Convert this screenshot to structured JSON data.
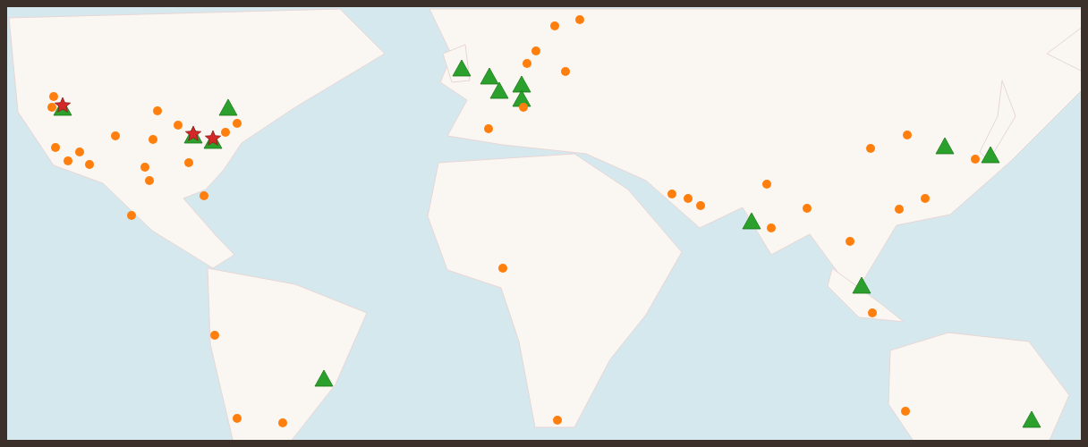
{
  "markers": [
    {
      "kind": "triangle",
      "color": "#2ca02c"
    },
    {
      "kind": "triangle",
      "color": "#2ca02c"
    },
    {
      "kind": "triangle",
      "color": "#2ca02c"
    },
    {
      "kind": "triangle",
      "color": "#2ca02c"
    },
    {
      "kind": "triangle",
      "color": "#2ca02c"
    },
    {
      "kind": "triangle",
      "color": "#2ca02c"
    },
    {
      "kind": "triangle",
      "color": "#2ca02c"
    },
    {
      "kind": "triangle",
      "color": "#2ca02c"
    },
    {
      "kind": "triangle",
      "color": "#2ca02c"
    },
    {
      "kind": "triangle",
      "color": "#2ca02c"
    },
    {
      "kind": "triangle",
      "color": "#2ca02c"
    },
    {
      "kind": "triangle",
      "color": "#2ca02c"
    },
    {
      "kind": "triangle",
      "color": "#2ca02c"
    },
    {
      "kind": "triangle",
      "color": "#2ca02c"
    },
    {
      "kind": "triangle",
      "color": "#2ca02c"
    },
    {
      "kind": "circle",
      "color": "#ff7f0e"
    },
    {
      "kind": "circle",
      "color": "#ff7f0e"
    },
    {
      "kind": "circle",
      "color": "#ff7f0e"
    },
    {
      "kind": "circle",
      "color": "#ff7f0e"
    },
    {
      "kind": "circle",
      "color": "#ff7f0e"
    },
    {
      "kind": "circle",
      "color": "#ff7f0e"
    },
    {
      "kind": "circle",
      "color": "#ff7f0e"
    },
    {
      "kind": "circle",
      "color": "#ff7f0e"
    },
    {
      "kind": "circle",
      "color": "#ff7f0e"
    },
    {
      "kind": "circle",
      "color": "#ff7f0e"
    },
    {
      "kind": "circle",
      "color": "#ff7f0e"
    },
    {
      "kind": "circle",
      "color": "#ff7f0e"
    },
    {
      "kind": "circle",
      "color": "#ff7f0e"
    },
    {
      "kind": "circle",
      "color": "#ff7f0e"
    },
    {
      "kind": "circle",
      "color": "#ff7f0e"
    },
    {
      "kind": "circle",
      "color": "#ff7f0e"
    },
    {
      "kind": "circle",
      "color": "#ff7f0e"
    },
    {
      "kind": "circle",
      "color": "#ff7f0e"
    },
    {
      "kind": "circle",
      "color": "#ff7f0e"
    },
    {
      "kind": "circle",
      "color": "#ff7f0e"
    },
    {
      "kind": "circle",
      "color": "#ff7f0e"
    },
    {
      "kind": "circle",
      "color": "#ff7f0e"
    },
    {
      "kind": "circle",
      "color": "#ff7f0e"
    },
    {
      "kind": "circle",
      "color": "#ff7f0e"
    },
    {
      "kind": "circle",
      "color": "#ff7f0e"
    },
    {
      "kind": "circle",
      "color": "#ff7f0e"
    },
    {
      "kind": "circle",
      "color": "#ff7f0e"
    },
    {
      "kind": "circle",
      "color": "#ff7f0e"
    },
    {
      "kind": "circle",
      "color": "#ff7f0e"
    },
    {
      "kind": "circle",
      "color": "#ff7f0e"
    },
    {
      "kind": "circle",
      "color": "#ff7f0e"
    },
    {
      "kind": "circle",
      "color": "#ff7f0e"
    },
    {
      "kind": "circle",
      "color": "#ff7f0e"
    },
    {
      "kind": "circle",
      "color": "#ff7f0e"
    },
    {
      "kind": "circle",
      "color": "#ff7f0e"
    },
    {
      "kind": "circle",
      "color": "#ff7f0e"
    },
    {
      "kind": "circle",
      "color": "#ff7f0e"
    },
    {
      "kind": "circle",
      "color": "#ff7f0e"
    },
    {
      "kind": "circle",
      "color": "#ff7f0e"
    },
    {
      "kind": "circle",
      "color": "#ff7f0e"
    },
    {
      "kind": "circle",
      "color": "#ff7f0e"
    },
    {
      "kind": "circle",
      "color": "#ff7f0e"
    },
    {
      "kind": "circle",
      "color": "#ff7f0e"
    },
    {
      "kind": "star",
      "color": "#d62728"
    },
    {
      "kind": "star",
      "color": "#d62728"
    },
    {
      "kind": "star",
      "color": "#d62728"
    }
  ]
}
